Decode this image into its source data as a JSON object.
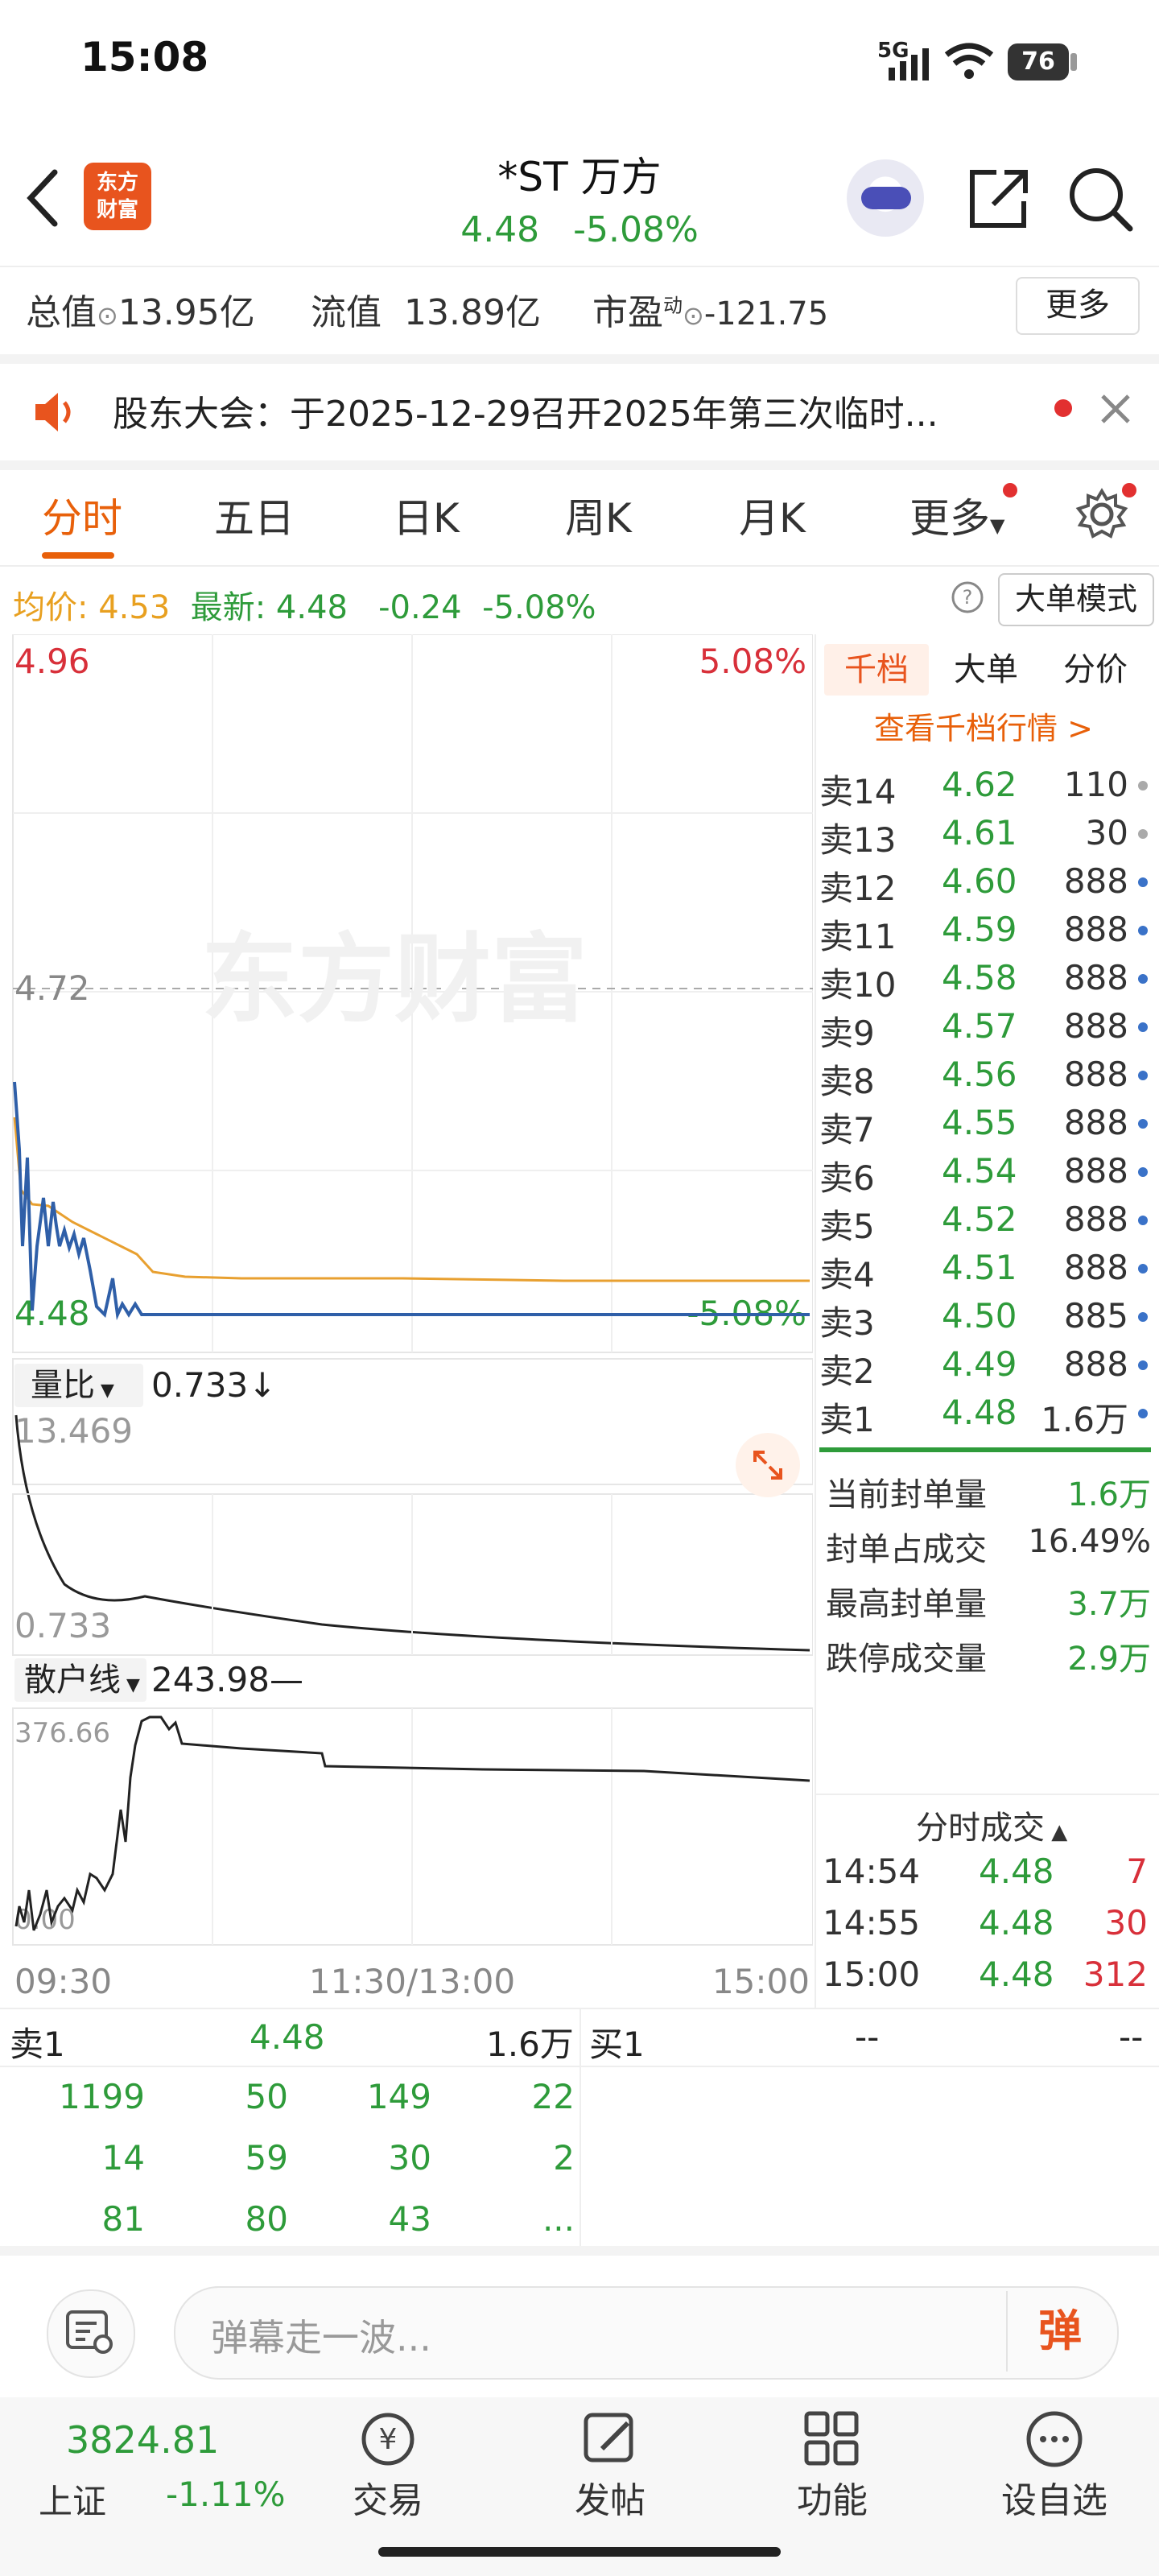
{
  "status_bar": {
    "time": "15:08",
    "network": "5G",
    "battery": "76"
  },
  "header": {
    "logo_text_line1": "东方",
    "logo_text_line2": "财富",
    "stock_name": "*ST 万方",
    "price": "4.48",
    "change_pct": "-5.08%"
  },
  "metrics": {
    "total_value_label": "总值",
    "total_value": "13.95亿",
    "float_value_label": "流值",
    "float_value": "13.89亿",
    "pe_label": "市盈",
    "pe_superscript": "动",
    "pe_value": "-121.75",
    "more_button": "更多"
  },
  "notice": {
    "text": "股东大会：于2025-12-29召开2025年第三次临时..."
  },
  "tabs": [
    "分时",
    "五日",
    "日K",
    "周K",
    "月K",
    "更多"
  ],
  "price_info": {
    "avg_label": "均价:",
    "avg_value": "4.53",
    "latest_label": "最新:",
    "latest_value": "4.48",
    "change": "-0.24",
    "change_pct": "-5.08%",
    "big_order_button": "大单模式"
  },
  "chart": {
    "high_price": "4.96",
    "high_pct": "5.08%",
    "mid_price": "4.72",
    "low_price": "4.48",
    "low_pct": "-5.08%",
    "watermark": "东方财富",
    "volume_ratio_label": "量比",
    "volume_ratio_value": "0.733↓",
    "volume_ratio_max": "13.469",
    "volume_ratio_min": "0.733",
    "retail_line_label": "散户线",
    "retail_line_value": "243.98—",
    "retail_max": "376.66",
    "retail_min": "0.00",
    "time_start": "09:30",
    "time_mid": "11:30/13:00",
    "time_end": "15:00"
  },
  "order_book": {
    "tabs": [
      "千档",
      "大单",
      "分价"
    ],
    "link": "查看千档行情 >",
    "asks": [
      {
        "label": "卖14",
        "price": "4.62",
        "vol": "110"
      },
      {
        "label": "卖13",
        "price": "4.61",
        "vol": "30"
      },
      {
        "label": "卖12",
        "price": "4.60",
        "vol": "888"
      },
      {
        "label": "卖11",
        "price": "4.59",
        "vol": "888"
      },
      {
        "label": "卖10",
        "price": "4.58",
        "vol": "888"
      },
      {
        "label": "卖9",
        "price": "4.57",
        "vol": "888"
      },
      {
        "label": "卖8",
        "price": "4.56",
        "vol": "888"
      },
      {
        "label": "卖7",
        "price": "4.55",
        "vol": "888"
      },
      {
        "label": "卖6",
        "price": "4.54",
        "vol": "888"
      },
      {
        "label": "卖5",
        "price": "4.52",
        "vol": "888"
      },
      {
        "label": "卖4",
        "price": "4.51",
        "vol": "888"
      },
      {
        "label": "卖3",
        "price": "4.50",
        "vol": "885"
      },
      {
        "label": "卖2",
        "price": "4.49",
        "vol": "888"
      },
      {
        "label": "卖1",
        "price": "4.48",
        "vol": "1.6万"
      }
    ],
    "stats": [
      {
        "label": "当前封单量",
        "value": "1.6万"
      },
      {
        "label": "封单占成交",
        "value": "16.49%"
      },
      {
        "label": "最高封单量",
        "value": "3.7万"
      },
      {
        "label": "跌停成交量",
        "value": "2.9万"
      }
    ],
    "trades_title": "分时成交",
    "trades": [
      {
        "time": "14:54",
        "price": "4.48",
        "vol": "7"
      },
      {
        "time": "14:55",
        "price": "4.48",
        "vol": "30"
      },
      {
        "time": "15:00",
        "price": "4.48",
        "vol": "312"
      }
    ]
  },
  "levels": {
    "sell_label": "卖1",
    "sell_price": "4.48",
    "sell_vol": "1.6万",
    "buy_label": "买1",
    "buy_price": "--",
    "buy_vol": "--",
    "queue": [
      [
        "1199",
        "50",
        "149",
        "22"
      ],
      [
        "14",
        "59",
        "30",
        "2"
      ],
      [
        "81",
        "80",
        "43",
        "..."
      ]
    ]
  },
  "danmu": {
    "placeholder": "弹幕走一波...",
    "send": "弹"
  },
  "bottom_nav": {
    "index_value": "3824.81",
    "index_name": "上证",
    "index_change": "-1.11%",
    "items": [
      "交易",
      "发帖",
      "功能",
      "设自选"
    ]
  }
}
